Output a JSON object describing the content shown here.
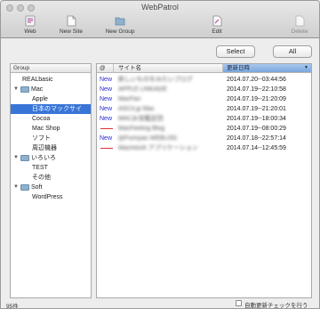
{
  "window": {
    "title": "WebPatrol"
  },
  "toolbar": {
    "web": "Web",
    "new_site": "New Site",
    "new_group": "New Group",
    "edit": "Edit",
    "delete": "Delete"
  },
  "buttons": {
    "select": "Select",
    "all": "All"
  },
  "group_panel": {
    "header": "Group",
    "items": [
      "REALbasic",
      "Mac",
      "Apple",
      "日本のマックサイ",
      "Cocoa",
      "Mac Shop",
      "ソフト",
      "周辺機器",
      "いろいろ",
      "TEST",
      "その他",
      "Soft",
      "WordPress"
    ],
    "selected": "日本のマックサイ"
  },
  "table": {
    "columns": {
      "status": "@",
      "site": "サイト名",
      "date": "更新日時"
    },
    "rows": [
      {
        "status": "New",
        "name": "新しいものをみたいブログ",
        "date": "2014.07.20--03:44:56"
      },
      {
        "status": "New",
        "name": "APPLE LINKAGE",
        "date": "2014.07.19--22:10:58"
      },
      {
        "status": "New",
        "name": "MacFan",
        "date": "2014.07.19--21:20:09"
      },
      {
        "status": "New",
        "name": "ASCII.jp Mac",
        "date": "2014.07.19--21:20:01"
      },
      {
        "status": "New",
        "name": "MACお宝鑑定団",
        "date": "2014.07.19--18:00:34"
      },
      {
        "status": "",
        "name": "MacFeeling Blog",
        "date": "2014.07.19--08:00:29"
      },
      {
        "status": "New",
        "name": "@Fumiyas WEBLOG",
        "date": "2014.07.18--22:57:14"
      },
      {
        "status": "",
        "name": "Macintosh アプリケーション",
        "date": "2014.07.14--12:45:59"
      }
    ]
  },
  "footer": {
    "count": "95件",
    "auto_check_label": "自動更新チェックを行う"
  },
  "colors": {
    "selection": "#3875d7",
    "new_status": "#2a2ad0",
    "removed_mark": "#dd3333"
  }
}
